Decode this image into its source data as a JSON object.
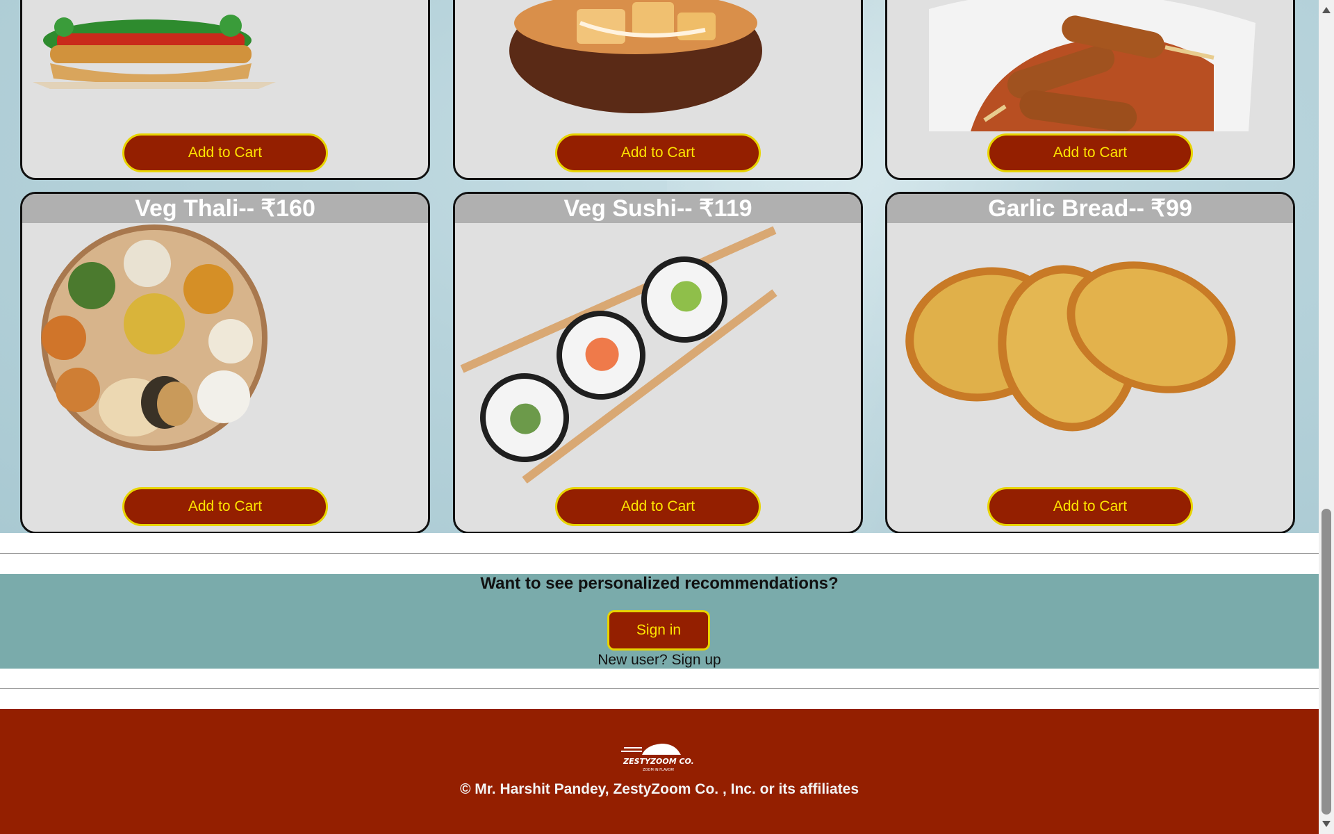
{
  "menu": {
    "top_row": [
      {
        "dish": "burger",
        "button_label": "Add to Cart"
      },
      {
        "dish": "paneer-curry",
        "button_label": "Add to Cart"
      },
      {
        "dish": "seekh-kebab",
        "button_label": "Add to Cart"
      }
    ],
    "items": [
      {
        "title": "Veg Thali-- ₹160",
        "button_label": "Add to Cart"
      },
      {
        "title": "Veg Sushi-- ₹119",
        "button_label": "Add to Cart"
      },
      {
        "title": "Garlic Bread-- ₹99",
        "button_label": "Add to Cart"
      }
    ]
  },
  "recommendation": {
    "question": "Want to see personalized recommendations?",
    "signin_label": "Sign in",
    "newuser_text": "New user?",
    "signup_label": "Sign up"
  },
  "footer": {
    "logo_text": "ZESTYZOOM CO.",
    "logo_tagline": "ZOOM IN FLAVOR!",
    "copyright": "© Mr. Harshit Pandey, ZestyZoom Co. , Inc. or its affiliates"
  },
  "colors": {
    "button_bg": "#941f00",
    "button_text": "#ffe500",
    "band_bg": "#7aabab",
    "footer_bg": "#941f00",
    "card_bg": "#e0e0e0",
    "card_title_bg": "#b0b0b0"
  },
  "icons": {
    "footer_logo": "zestyzoom-logo-icon"
  }
}
